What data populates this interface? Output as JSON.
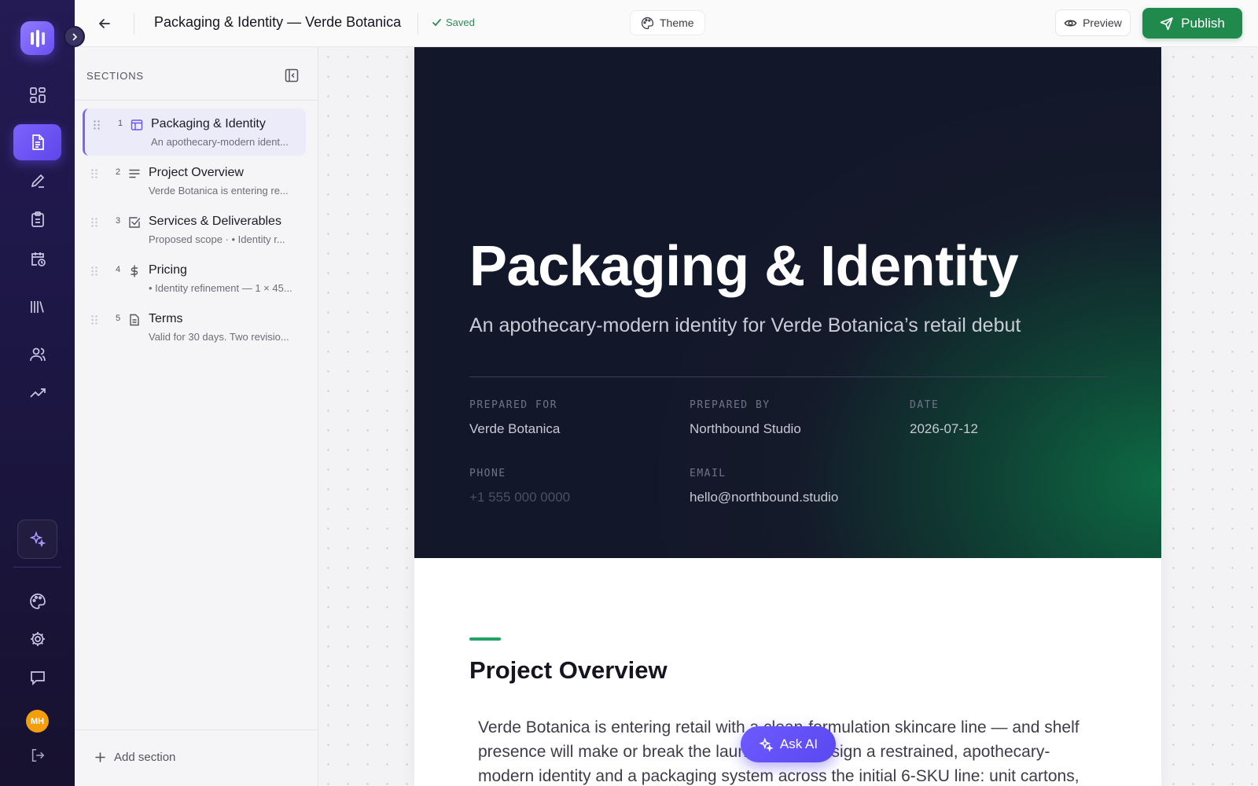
{
  "topbar": {
    "doc_title": "Packaging & Identity — Verde Botanica",
    "saved_label": "Saved",
    "theme_label": "Theme",
    "preview_label": "Preview",
    "publish_label": "Publish"
  },
  "rail": {
    "nav_icons": [
      "grid-icon",
      "document-icon",
      "pen-icon",
      "clipboard-icon",
      "calendar-clock-icon",
      "library-icon",
      "users-icon",
      "trending-up-icon"
    ],
    "bottom_icons": [
      "palette-icon",
      "settings-icon",
      "message-icon",
      "logout-icon"
    ],
    "avatar_initials": "MH"
  },
  "sections": {
    "header": "SECTIONS",
    "items": [
      {
        "num": "1",
        "icon": "layout-icon",
        "title": "Packaging & Identity",
        "subtitle": "An apothecary-modern ident..."
      },
      {
        "num": "2",
        "icon": "align-left-icon",
        "title": "Project Overview",
        "subtitle": "Verde Botanica is entering re..."
      },
      {
        "num": "3",
        "icon": "checkbox-icon",
        "title": "Services & Deliverables",
        "subtitle": "Proposed scope · • Identity r..."
      },
      {
        "num": "4",
        "icon": "dollar-icon",
        "title": "Pricing",
        "subtitle": "• Identity refinement — 1 × 45..."
      },
      {
        "num": "5",
        "icon": "file-icon",
        "title": "Terms",
        "subtitle": "Valid for 30 days. Two revisio..."
      }
    ],
    "add_label": "Add section"
  },
  "hero": {
    "title": "Packaging & Identity",
    "subtitle": "An apothecary-modern identity for Verde Botanica’s retail debut",
    "meta": {
      "prepared_for_label": "PREPARED FOR",
      "prepared_for": "Verde Botanica",
      "prepared_by_label": "PREPARED BY",
      "prepared_by": "Northbound Studio",
      "date_label": "DATE",
      "date": "2026-07-12",
      "phone_label": "PHONE",
      "phone": "+1 555 000 0000",
      "email_label": "EMAIL",
      "email": "hello@northbound.studio"
    }
  },
  "overview": {
    "title": "Project Overview",
    "body": "Verde Botanica is entering retail with a clean-formulation skincare line — and shelf presence will make or break the launch. We'll design a restrained, apothecary-modern identity and a packaging system across the initial 6-SKU line: unit cartons,"
  },
  "ask_ai_label": "Ask AI",
  "colors": {
    "accent": "#7c63ff",
    "publish": "#1f8a4c",
    "saved": "#2e8b57",
    "hero_dark": "#13172a",
    "hero_green": "#0e6a44"
  }
}
